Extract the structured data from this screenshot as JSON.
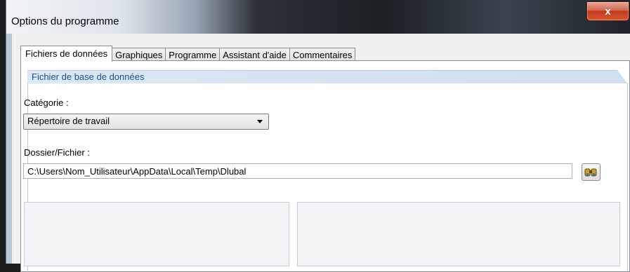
{
  "window": {
    "title": "Options du programme",
    "close_label": "x"
  },
  "tabs": [
    {
      "label": "Fichiers de données",
      "active": true
    },
    {
      "label": "Graphiques",
      "active": false
    },
    {
      "label": "Programme",
      "active": false
    },
    {
      "label": "Assistant d'aide",
      "active": false
    },
    {
      "label": "Commentaires",
      "active": false
    }
  ],
  "group": {
    "title": "Fichier de base de données"
  },
  "category": {
    "label": "Catégorie :",
    "selected": "Répertoire de travail"
  },
  "folder": {
    "label": "Dossier/Fichier :",
    "value": "C:\\Users\\Nom_Utilisateur\\AppData\\Local\\Temp\\Dlubal",
    "browse_icon": "binoculars-icon"
  },
  "colors": {
    "accent": "#1d4f8a",
    "header": "#dde8f5",
    "close": "#c23a1c"
  }
}
